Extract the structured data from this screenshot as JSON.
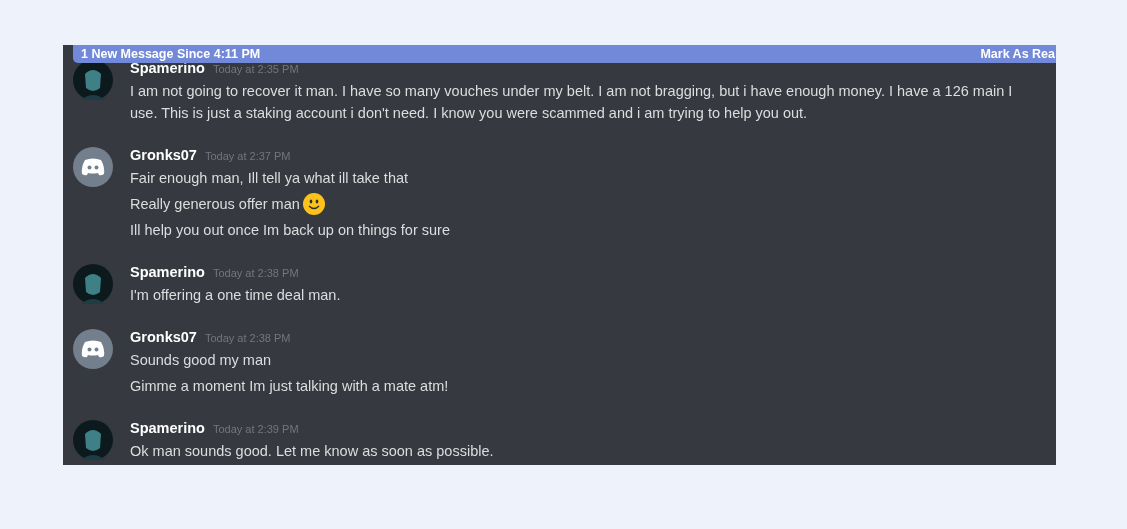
{
  "banner": {
    "text": "1 New Message Since 4:11 PM",
    "action": "Mark As Rea"
  },
  "messages": [
    {
      "author": "Spamerino",
      "time": "Today at 2:35 PM",
      "avatar": {
        "kind": "photo"
      },
      "lines": [
        {
          "text": "I am not going to recover it man. I have so many vouches under my belt. I am not bragging, but i have enough money. I have a 126  main I use. This is just a staking account i don't need. I know you were scammed and i am trying to help you out.",
          "emoji": false
        }
      ]
    },
    {
      "author": "Gronks07",
      "time": "Today at 2:37 PM",
      "avatar": {
        "kind": "default"
      },
      "lines": [
        {
          "text": "Fair enough man, Ill tell ya what ill take that",
          "emoji": false
        },
        {
          "text": "Really generous offer man",
          "emoji": true
        },
        {
          "text": "Ill help you out once Im back up on things for sure",
          "emoji": false
        }
      ]
    },
    {
      "author": "Spamerino",
      "time": "Today at 2:38 PM",
      "avatar": {
        "kind": "photo"
      },
      "lines": [
        {
          "text": "I'm offering a one time deal man.",
          "emoji": false
        }
      ]
    },
    {
      "author": "Gronks07",
      "time": "Today at 2:38 PM",
      "avatar": {
        "kind": "default"
      },
      "lines": [
        {
          "text": "Sounds good my man",
          "emoji": false
        },
        {
          "text": "Gimme a moment Im just talking with a mate atm!",
          "emoji": false
        }
      ]
    },
    {
      "author": "Spamerino",
      "time": "Today at 2:39 PM",
      "avatar": {
        "kind": "photo"
      },
      "lines": [
        {
          "text": "Ok man sounds good. Let me know as soon as possible.",
          "emoji": false
        }
      ]
    }
  ]
}
